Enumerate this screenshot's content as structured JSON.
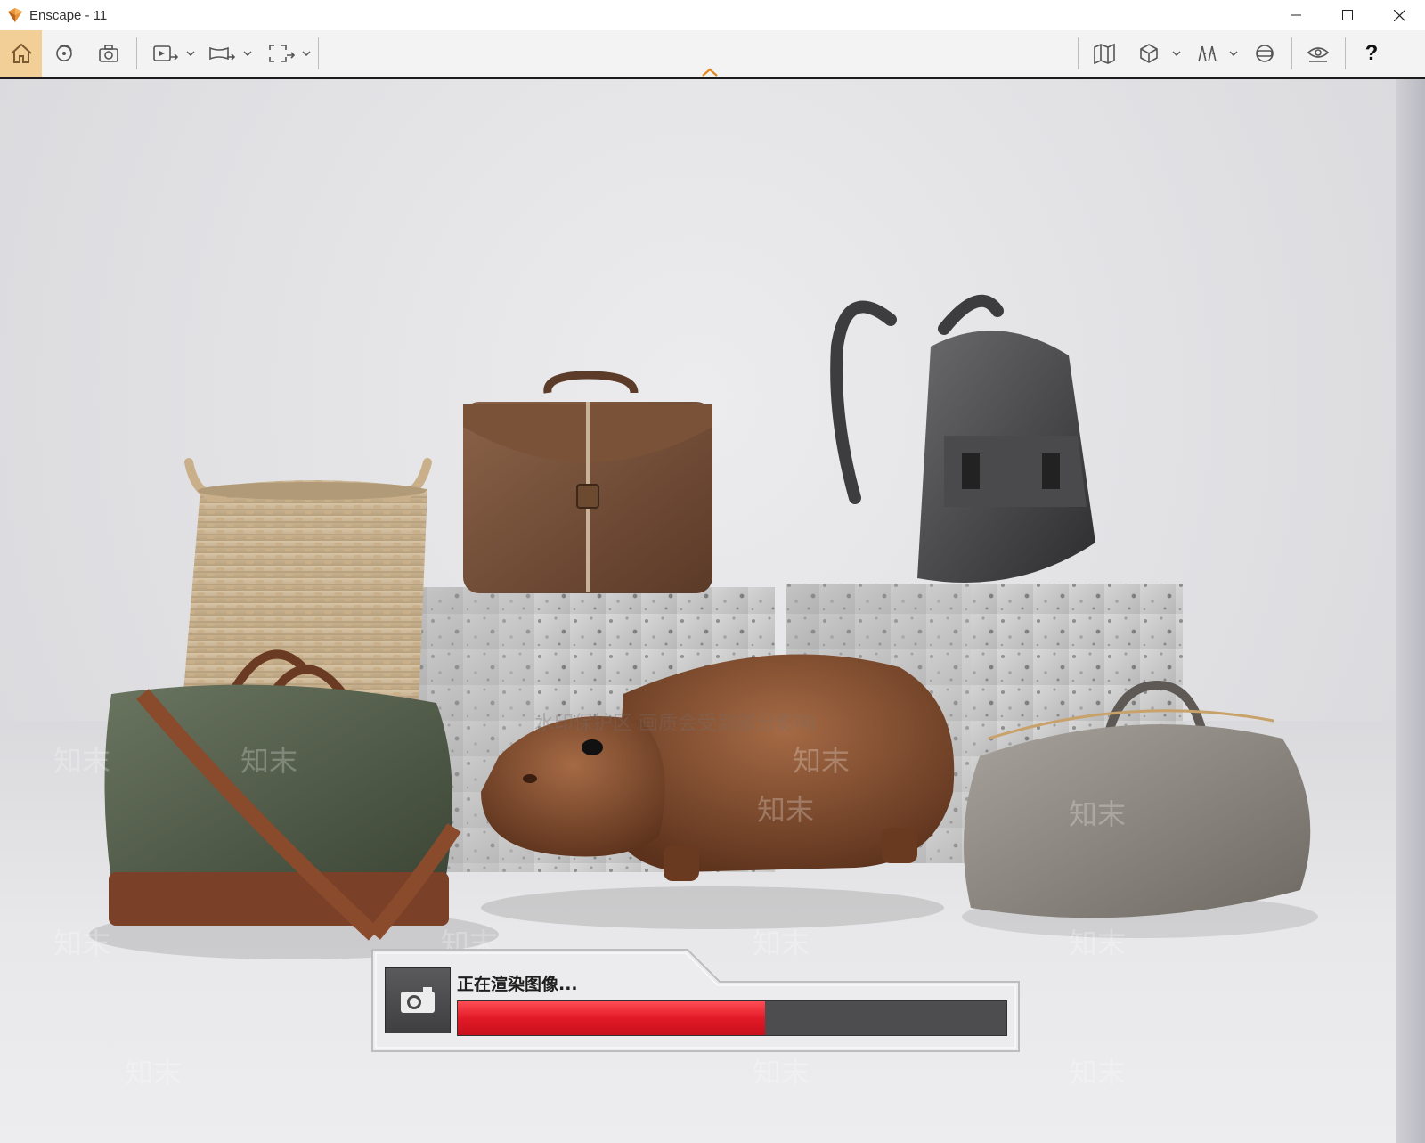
{
  "window": {
    "title": "Enscape - 11"
  },
  "toolbar": {
    "left_icons": [
      "home-icon",
      "orbit-icon",
      "screenshot-icon",
      "export-video-icon",
      "panorama-icon",
      "batch-render-icon"
    ],
    "right_icons": [
      "map-icon",
      "cube-view-icon",
      "asset-library-icon",
      "vr-headset-icon",
      "visual-settings-icon"
    ],
    "help_label": "?",
    "collapse_icon": "chevron-up-icon",
    "accent_color": "#f3cf98"
  },
  "viewport": {
    "watermark_text": "知末",
    "overlay_text": "水印保护区 画质会受到部分影响"
  },
  "render_dialog": {
    "status_text": "正在渲染图像...",
    "progress": 0.56,
    "progress_color": "#e21a27",
    "icon": "camera-icon"
  }
}
